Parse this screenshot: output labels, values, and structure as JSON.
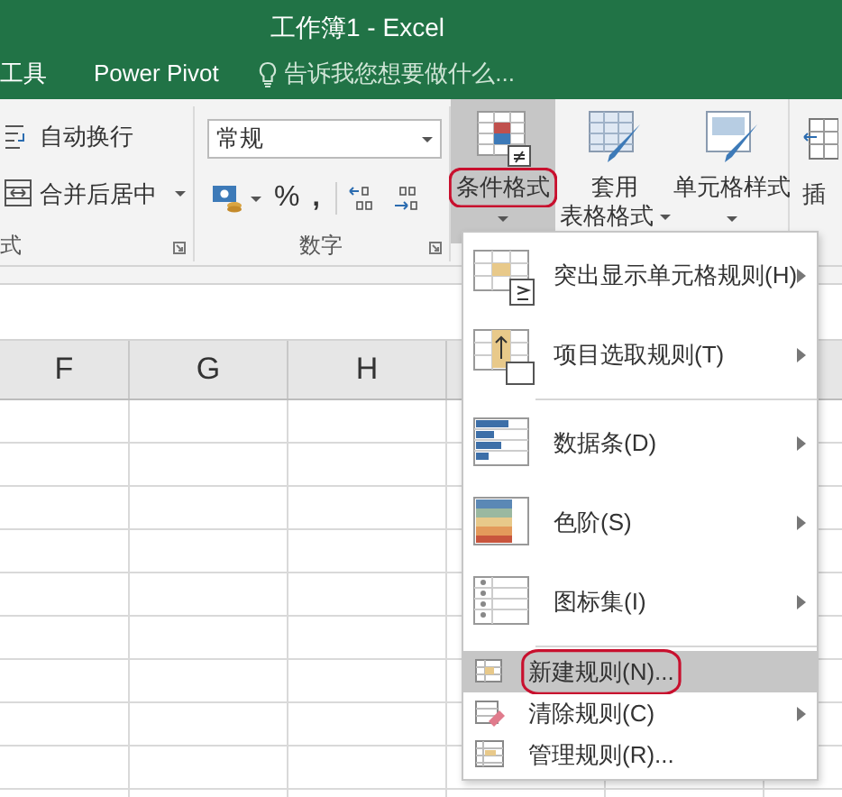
{
  "window": {
    "title": "工作簿1 - Excel"
  },
  "ribbon_tabs": [
    {
      "label": "工具"
    },
    {
      "label": "Power Pivot"
    }
  ],
  "tell_me": {
    "placeholder": "告诉我您想要做什么..."
  },
  "alignment_group": {
    "label": "式",
    "buttons": [
      {
        "kind": "wrap",
        "label": "自动换行",
        "dropdown": false
      },
      {
        "kind": "merge",
        "label": "合并后居中",
        "dropdown": true
      }
    ]
  },
  "number_group": {
    "label": "数字",
    "format": "常规",
    "buttons": [
      {
        "kind": "currency",
        "dropdown": true
      },
      {
        "kind": "percent",
        "label": "%"
      },
      {
        "kind": "comma",
        "label": ","
      },
      {
        "kind": "increase_decimal"
      },
      {
        "kind": "decrease_decimal"
      }
    ]
  },
  "styles_group": {
    "buttons": [
      {
        "kind": "conditional",
        "lines": [
          "条件格式"
        ],
        "pressed": true,
        "circled": true
      },
      {
        "kind": "table",
        "lines": [
          "套用",
          "表格格式"
        ],
        "pressed": false,
        "circled": false
      },
      {
        "kind": "cellstyle",
        "lines": [
          "单元格样式"
        ],
        "pressed": false,
        "circled": false
      }
    ]
  },
  "cells_group": {
    "label": "插"
  },
  "columns": [
    "F",
    "G",
    "H"
  ],
  "menu": [
    {
      "kind": "large",
      "label": "突出显示单元格规则(H)",
      "submenu": true,
      "selected": false,
      "circled": false
    },
    {
      "kind": "large",
      "label": "项目选取规则(T)",
      "submenu": true,
      "selected": false,
      "circled": false
    },
    {
      "kind": "separator"
    },
    {
      "kind": "large",
      "label": "数据条(D)",
      "submenu": true,
      "selected": false,
      "circled": false
    },
    {
      "kind": "large",
      "label": "色阶(S)",
      "submenu": true,
      "selected": false,
      "circled": false
    },
    {
      "kind": "large",
      "label": "图标集(I)",
      "submenu": true,
      "selected": false,
      "circled": false
    },
    {
      "kind": "separator"
    },
    {
      "kind": "small",
      "label": "新建规则(N)...",
      "submenu": false,
      "selected": true,
      "circled": true
    },
    {
      "kind": "small",
      "label": "清除规则(C)",
      "submenu": true,
      "selected": false,
      "circled": false
    },
    {
      "kind": "small",
      "label": "管理规则(R)...",
      "submenu": false,
      "selected": false,
      "circled": false
    }
  ]
}
